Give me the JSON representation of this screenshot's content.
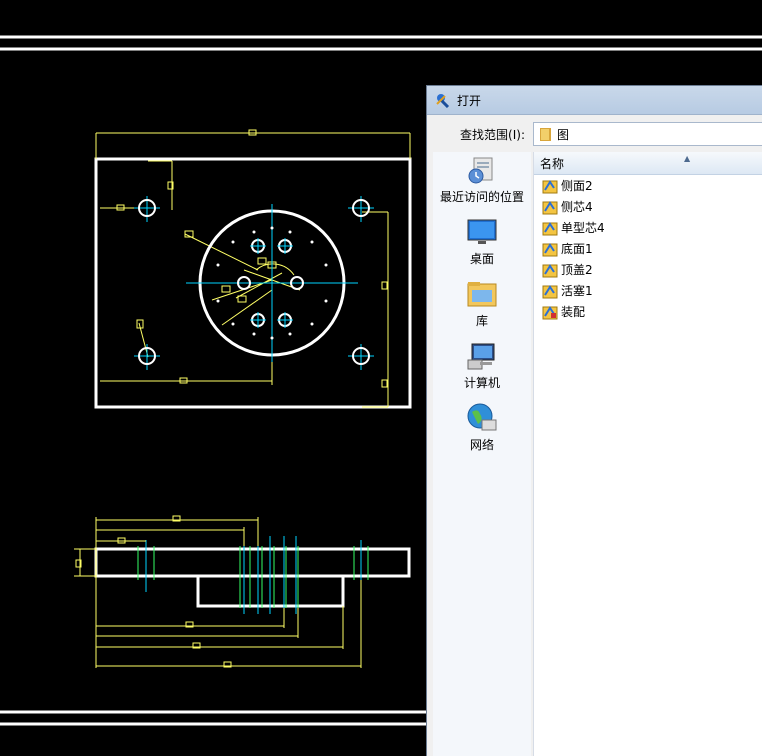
{
  "dialog": {
    "title": "打开",
    "look_in_label": "查找范围(I):",
    "look_in_value": "图"
  },
  "places": [
    {
      "label": "最近访问的位置",
      "icon": "recent-places-icon"
    },
    {
      "label": "桌面",
      "icon": "desktop-icon"
    },
    {
      "label": "库",
      "icon": "libraries-icon"
    },
    {
      "label": "计算机",
      "icon": "computer-icon"
    },
    {
      "label": "网络",
      "icon": "network-icon"
    }
  ],
  "file_list": {
    "column_name": "名称",
    "items": [
      "侧面2",
      "侧芯4",
      "单型芯4",
      "底面1",
      "顶盖2",
      "活塞1",
      "装配"
    ]
  },
  "colors": {
    "cad_background": "#000000",
    "cad_outline": "#ffffff",
    "cad_dimension": "#ffff66",
    "cad_centerline": "#00d4ff",
    "cad_hidden": "#33ff66"
  }
}
